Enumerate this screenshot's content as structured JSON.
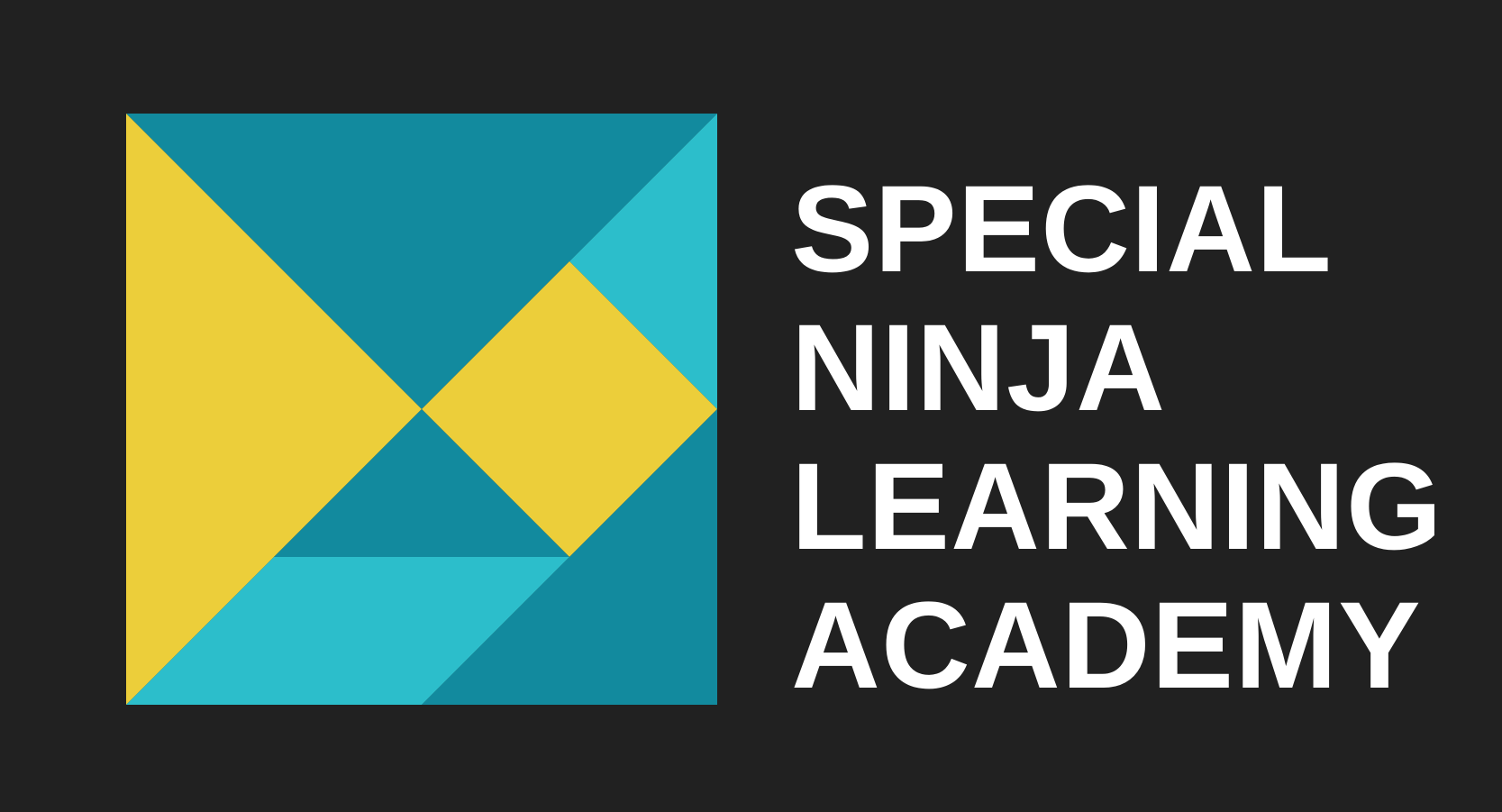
{
  "logo": {
    "colors": {
      "background": "#212121",
      "yellow": "#ecce3a",
      "teal_dark": "#128a9e",
      "teal_light": "#2cbecb",
      "text": "#ffffff"
    }
  },
  "wordmark": {
    "lines": [
      "SPECIAL",
      "NINJA",
      "LEARNING",
      "ACADEMY"
    ]
  }
}
